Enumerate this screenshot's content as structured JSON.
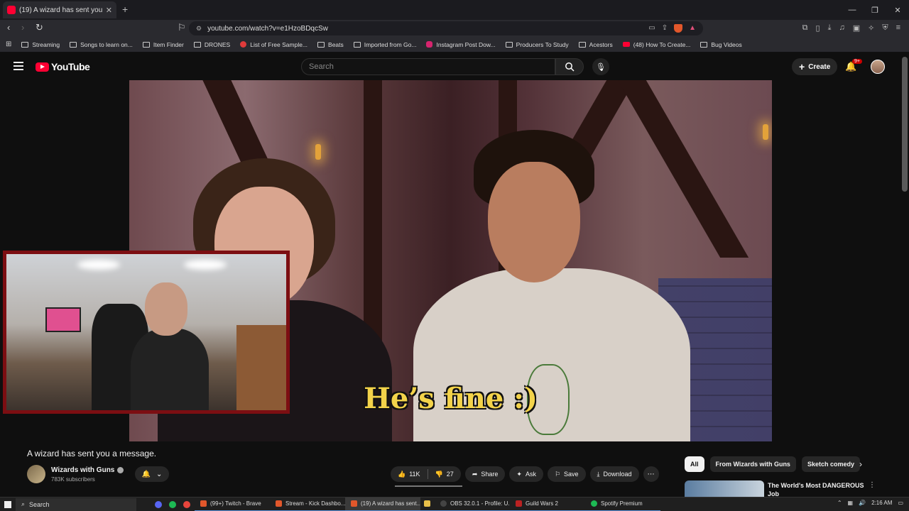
{
  "browser": {
    "tab_title": "(19) A wizard has sent you a",
    "url": "youtube.com/watch?v=e1HzoBDqcSw",
    "bookmarks": [
      "Streaming",
      "Songs to learn on...",
      "Item Finder",
      "DRONES",
      "List of Free Sample...",
      "Beats",
      "Imported from Go...",
      "Instagram Post Dow...",
      "Producers To Study",
      "Acestors",
      "(48) How To Create...",
      "Bug Videos"
    ]
  },
  "youtube": {
    "logo_text": "YouTube",
    "search_placeholder": "Search",
    "create_label": "Create",
    "notification_badge": "9+"
  },
  "video": {
    "subtitle": "He’s fine :)",
    "title": "A wizard has sent you a message.",
    "channel": "Wizards with Guns",
    "subscribers": "783K subscribers",
    "likes": "11K",
    "dislikes": "27",
    "share_label": "Share",
    "ask_label": "Ask",
    "save_label": "Save",
    "download_label": "Download"
  },
  "sidebar": {
    "chips": [
      "All",
      "From Wizards with Guns",
      "Sketch comedy"
    ],
    "recommended_title": "The World's Most DANGEROUS Job"
  },
  "taskbar": {
    "search_label": "Search",
    "apps": [
      "(99+) Twitch - Brave",
      "Stream - Kick Dashbo...",
      "(19) A wizard has sent...",
      "OBS 32.0.1 - Profile: U...",
      "Guild Wars 2",
      "Spotify Premium"
    ],
    "time": "2:16 AM"
  },
  "colors": {
    "yt_red": "#ff0033",
    "webcam_border": "#7c0e12",
    "subtitle_yellow": "#f3d34a"
  }
}
